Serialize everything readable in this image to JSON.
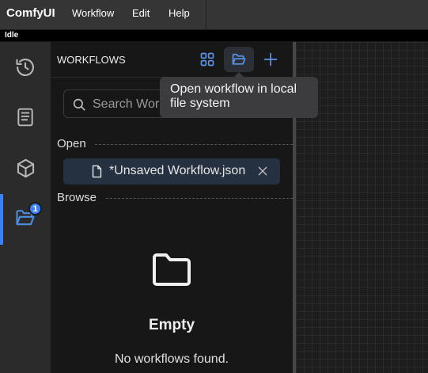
{
  "app": {
    "brand": "ComfyUI"
  },
  "menu": {
    "workflow": "Workflow",
    "edit": "Edit",
    "help": "Help"
  },
  "status": {
    "text": "Idle"
  },
  "sidebar": {
    "items": [
      {
        "icon": "history-icon"
      },
      {
        "icon": "book-icon"
      },
      {
        "icon": "cube-icon"
      },
      {
        "icon": "folder-open-icon",
        "active": true,
        "badge": "1"
      }
    ]
  },
  "panel": {
    "title": "WORKFLOWS",
    "search": {
      "placeholder": "Search Workflow"
    },
    "open_label": "Open",
    "open_items": [
      {
        "name": "*Unsaved Workflow.json"
      }
    ],
    "browse_label": "Browse",
    "empty_title": "Empty",
    "empty_message": "No workflows found."
  },
  "tooltip": {
    "text": "Open workflow in local file system"
  },
  "colors": {
    "accent": "#3b82f6",
    "active_item_bg": "#253040",
    "panel_bg": "#171718"
  }
}
